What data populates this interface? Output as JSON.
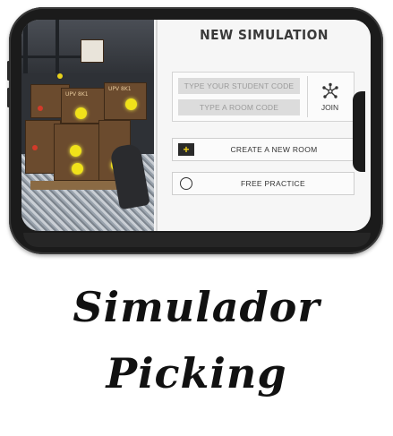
{
  "app": {
    "screen_title": "NEW SIMULATION",
    "inputs": {
      "student_code_placeholder": "TYPE YOUR STUDENT CODE",
      "room_code_placeholder": "TYPE A ROOM CODE"
    },
    "join_label": "JOIN",
    "create_room_label": "CREATE A NEW ROOM",
    "free_practice_label": "FREE PRACTICE",
    "box_tag": "UPV 8K1"
  },
  "caption": {
    "line1": "Simulador",
    "line2": "Picking"
  },
  "colors": {
    "accent_yellow": "#f0e21a",
    "text_dark": "#3a3a3a",
    "field_bg": "#dcdcdc"
  },
  "icons": {
    "join": "network-nodes-icon",
    "create": "plus-icon",
    "practice": "circle-icon"
  }
}
